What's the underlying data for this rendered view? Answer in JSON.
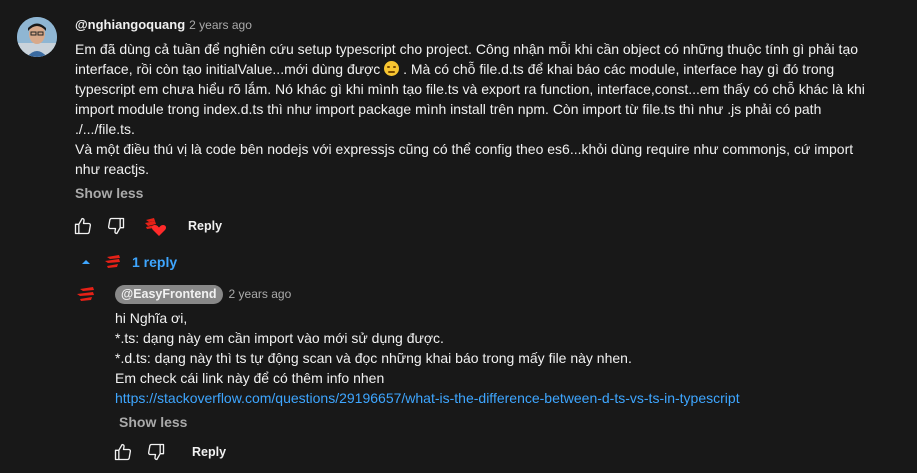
{
  "comment": {
    "author": "@nghiangoquang",
    "time": "2 years ago",
    "lines": [
      "Em đã dùng cả tuần để nghiên cứu setup typescript cho project. Công nhận mỗi khi cần object có những thuộc tính gì phải tạo",
      "interface, rồi còn tạo initialValue...mới dùng được",
      ". Mà có chỗ file.d.ts để khai báo các module, interface hay gì đó trong",
      "typescript em chưa hiểu rõ lắm. Nó khác gì khi mình tạo file.ts và export ra function, interface,const...em thấy có chỗ khác là khi",
      "import module trong index.d.ts thì như import package mình install trên npm. Còn import từ file.ts thì như .js phải có path",
      "./.../file.ts.",
      "Và một điều thú vị là code bên nodejs với expressjs cũng có thể config theo es6...khỏi dùng require như commonjs, cứ import",
      "như reactjs."
    ],
    "show_less": "Show less",
    "reply_label": "Reply"
  },
  "replies_toggle": "1 reply",
  "reply": {
    "author": "@EasyFrontend",
    "time": "2 years ago",
    "lines": [
      "hi Nghĩa ơi,",
      "*.ts: dạng này em cần import vào mới sử dụng được.",
      "*.d.ts: dạng này thì ts tự động scan và đọc những khai báo trong mấy file này nhen.",
      "Em check cái link này để có thêm info nhen"
    ],
    "link": "https://stackoverflow.com/questions/29196657/what-is-the-difference-between-d-ts-vs-ts-in-typescript",
    "show_less": "Show less",
    "reply_label": "Reply"
  },
  "colors": {
    "background": "#181818",
    "text": "#f1f1f1",
    "secondary_text": "#aaaaaa",
    "link": "#3ea6ff",
    "brand_red": "#e62117",
    "author_chip": "#888888"
  },
  "icons": [
    "thumbs-up-icon",
    "thumbs-down-icon",
    "creator-heart-icon",
    "caret-up-icon",
    "channel-logo-icon"
  ]
}
